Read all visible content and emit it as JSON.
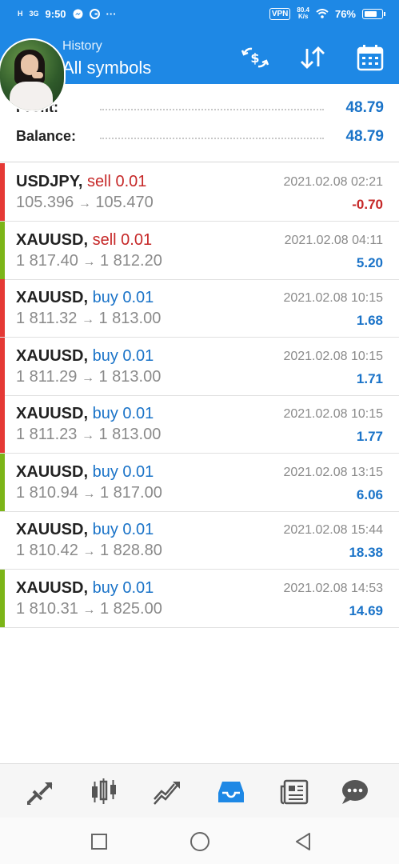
{
  "status_bar": {
    "signal1": "H",
    "signal2": "3G",
    "time": "9:50",
    "more": "···",
    "vpn": "VPN",
    "speed_value": "80.4",
    "speed_unit": "K/s",
    "battery": "76%"
  },
  "header": {
    "subtitle": "History",
    "title": "All symbols"
  },
  "summary": {
    "profit_label": "Profit:",
    "profit_value": "48.79",
    "balance_label": "Balance:",
    "balance_value": "48.79"
  },
  "colors": {
    "header_bg": "#1E88E5",
    "sell": "#c62828",
    "buy": "#1a73c8",
    "profit_pos": "#1a73c8",
    "profit_neg": "#c62828",
    "bar_red": "#e53935",
    "bar_green": "#7cb518",
    "accent": "#1E88E5"
  },
  "deals": [
    {
      "symbol": "USDJPY,",
      "type": "sell 0.01",
      "side": "sell",
      "open": "105.396",
      "arrow": "→",
      "close": "105.470",
      "time": "2021.02.08 02:21",
      "profit": "-0.70",
      "bar": "red"
    },
    {
      "symbol": "XAUUSD,",
      "type": "sell 0.01",
      "side": "sell",
      "open": "1 817.40",
      "arrow": "→",
      "close": "1 812.20",
      "time": "2021.02.08 04:11",
      "profit": "5.20",
      "bar": "green"
    },
    {
      "symbol": "XAUUSD,",
      "type": "buy 0.01",
      "side": "buy",
      "open": "1 811.32",
      "arrow": "→",
      "close": "1 813.00",
      "time": "2021.02.08 10:15",
      "profit": "1.68",
      "bar": "red"
    },
    {
      "symbol": "XAUUSD,",
      "type": "buy 0.01",
      "side": "buy",
      "open": "1 811.29",
      "arrow": "→",
      "close": "1 813.00",
      "time": "2021.02.08 10:15",
      "profit": "1.71",
      "bar": "red"
    },
    {
      "symbol": "XAUUSD,",
      "type": "buy 0.01",
      "side": "buy",
      "open": "1 811.23",
      "arrow": "→",
      "close": "1 813.00",
      "time": "2021.02.08 10:15",
      "profit": "1.77",
      "bar": "red"
    },
    {
      "symbol": "XAUUSD,",
      "type": "buy 0.01",
      "side": "buy",
      "open": "1 810.94",
      "arrow": "→",
      "close": "1 817.00",
      "time": "2021.02.08 13:15",
      "profit": "6.06",
      "bar": "green"
    },
    {
      "symbol": "XAUUSD,",
      "type": "buy 0.01",
      "side": "buy",
      "open": "1 810.42",
      "arrow": "→",
      "close": "1 828.80",
      "time": "2021.02.08 15:44",
      "profit": "18.38",
      "bar": "none"
    },
    {
      "symbol": "XAUUSD,",
      "type": "buy 0.01",
      "side": "buy",
      "open": "1 810.31",
      "arrow": "→",
      "close": "1 825.00",
      "time": "2021.02.08 14:53",
      "profit": "14.69",
      "bar": "green"
    }
  ],
  "bottom_nav": [
    {
      "name": "quotes-tab",
      "icon": "quotes-icon",
      "active": false
    },
    {
      "name": "chart-tab",
      "icon": "candlestick-icon",
      "active": false
    },
    {
      "name": "trade-tab",
      "icon": "trade-icon",
      "active": false
    },
    {
      "name": "history-tab",
      "icon": "inbox-icon",
      "active": true
    },
    {
      "name": "news-tab",
      "icon": "news-icon",
      "active": false
    },
    {
      "name": "messages-tab",
      "icon": "chat-icon",
      "active": false
    }
  ],
  "system_nav": [
    "square-icon",
    "circle-icon",
    "triangle-back-icon"
  ]
}
